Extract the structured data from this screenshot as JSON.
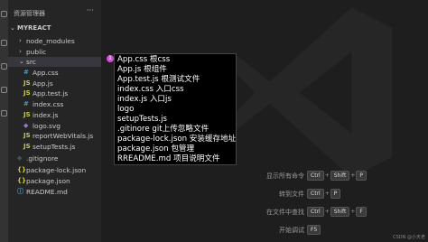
{
  "sidebar": {
    "title": "资源管理器",
    "more": "···",
    "project": "MYREACT",
    "items": [
      {
        "label": "node_modules",
        "type": "folder",
        "arrow": "›"
      },
      {
        "label": "public",
        "type": "folder",
        "arrow": "›"
      },
      {
        "label": "src",
        "type": "folder",
        "arrow": "⌄"
      },
      {
        "label": "App.css",
        "type": "css",
        "icon": "#"
      },
      {
        "label": "App.js",
        "type": "js",
        "icon": "JS"
      },
      {
        "label": "App.test.js",
        "type": "js",
        "icon": "JS"
      },
      {
        "label": "index.css",
        "type": "css",
        "icon": "#"
      },
      {
        "label": "index.js",
        "type": "js",
        "icon": "JS"
      },
      {
        "label": "logo.svg",
        "type": "svg",
        "icon": "◆"
      },
      {
        "label": "reportWebVitals.js",
        "type": "js",
        "icon": "JS"
      },
      {
        "label": "setupTests.js",
        "type": "js",
        "icon": "JS"
      },
      {
        "label": ".gitignore",
        "type": "git",
        "icon": "◆"
      },
      {
        "label": "package-lock.json",
        "type": "json",
        "icon": "{}"
      },
      {
        "label": "package.json",
        "type": "json",
        "icon": "{}"
      },
      {
        "label": "README.md",
        "type": "md",
        "icon": "ⓘ"
      }
    ]
  },
  "callout": {
    "badge": "1",
    "lines": [
      "App.css 根css",
      "App.js 根组件",
      "App.test.js 根测试文件",
      "index.css 入口css",
      "index.js 入口js",
      "logo",
      "setupTests.js",
      ".gitinore git上传忽略文件",
      "package-lock.json 安装缓存地址",
      "package.json 包管理",
      "RREADME.md 项目说明文件"
    ]
  },
  "shortcuts": [
    {
      "label": "显示所有命令",
      "keys": [
        "Ctrl",
        "Shift",
        "P"
      ]
    },
    {
      "label": "转到文件",
      "keys": [
        "Ctrl",
        "P"
      ]
    },
    {
      "label": "在文件中查找",
      "keys": [
        "Ctrl",
        "Shift",
        "F"
      ]
    },
    {
      "label": "开始调试",
      "keys": [
        "F5"
      ]
    }
  ],
  "credit": "CSDN @小天老",
  "colors": {
    "css": "#519aba",
    "js": "#cbcb41",
    "svg": "#a074c4",
    "git": "#41535b",
    "json": "#cbcb41",
    "md": "#519aba",
    "folder": "#c5c5c5"
  }
}
